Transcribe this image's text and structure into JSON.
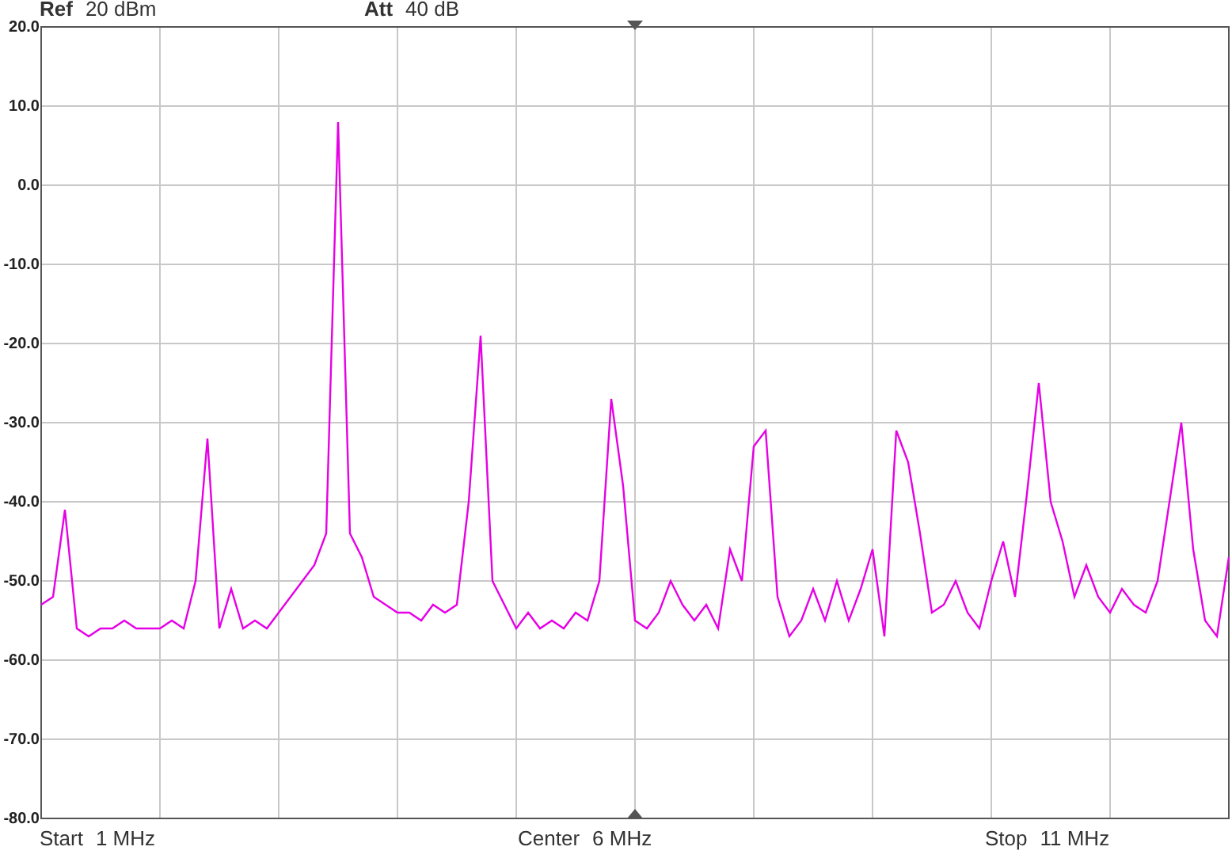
{
  "header": [
    {
      "label": "Ref",
      "value": "20 dBm"
    },
    {
      "label": "Att",
      "value": "40 dB"
    }
  ],
  "spectrum": {
    "chart_data": {
      "type": "line",
      "grid": true,
      "ylim": [
        -80,
        20
      ],
      "yticks": [
        {
          "value": 20,
          "label": "20.0"
        },
        {
          "value": 10,
          "label": "10.0"
        },
        {
          "value": 0,
          "label": "0.0"
        },
        {
          "value": -10,
          "label": "-10.0"
        },
        {
          "value": -20,
          "label": "-20.0"
        },
        {
          "value": -30,
          "label": "-30.0"
        },
        {
          "value": -40,
          "label": "-40.0"
        },
        {
          "value": -50,
          "label": "-50.0"
        },
        {
          "value": -60,
          "label": "-60.0"
        },
        {
          "value": -70,
          "label": "-70.0"
        },
        {
          "value": -80,
          "label": "-80.0"
        }
      ],
      "series": [
        {
          "color": "#e600e6",
          "values": [
            -53,
            -52,
            -41,
            -56,
            -57,
            -56,
            -56,
            -55,
            -56,
            -56,
            -56,
            -55,
            -56,
            -50,
            -32,
            -56,
            -51,
            -56,
            -55,
            -56,
            -54,
            -52,
            -50,
            -48,
            -44,
            8,
            -44,
            -47,
            -52,
            -53,
            -54,
            -54,
            -55,
            -53,
            -54,
            -53,
            -40,
            -19,
            -50,
            -53,
            -56,
            -54,
            -56,
            -55,
            -56,
            -54,
            -55,
            -50,
            -27,
            -38,
            -55,
            -56,
            -54,
            -50,
            -53,
            -55,
            -53,
            -56,
            -46,
            -50,
            -33,
            -31,
            -52,
            -57,
            -55,
            -51,
            -55,
            -50,
            -55,
            -51,
            -46,
            -57,
            -31,
            -35,
            -44,
            -54,
            -53,
            -50,
            -54,
            -56,
            -50,
            -45,
            -52,
            -39,
            -25,
            -40,
            -45,
            -52,
            -48,
            -52,
            -54,
            -51,
            -53,
            -54,
            -50,
            -40,
            -30,
            -46,
            -55,
            -57,
            -47
          ]
        }
      ]
    }
  },
  "footer": [
    {
      "label": "Start",
      "value": "1 MHz"
    },
    {
      "label": "Center",
      "value": "6 MHz"
    },
    {
      "label": "Stop",
      "value": "11 MHz"
    }
  ]
}
